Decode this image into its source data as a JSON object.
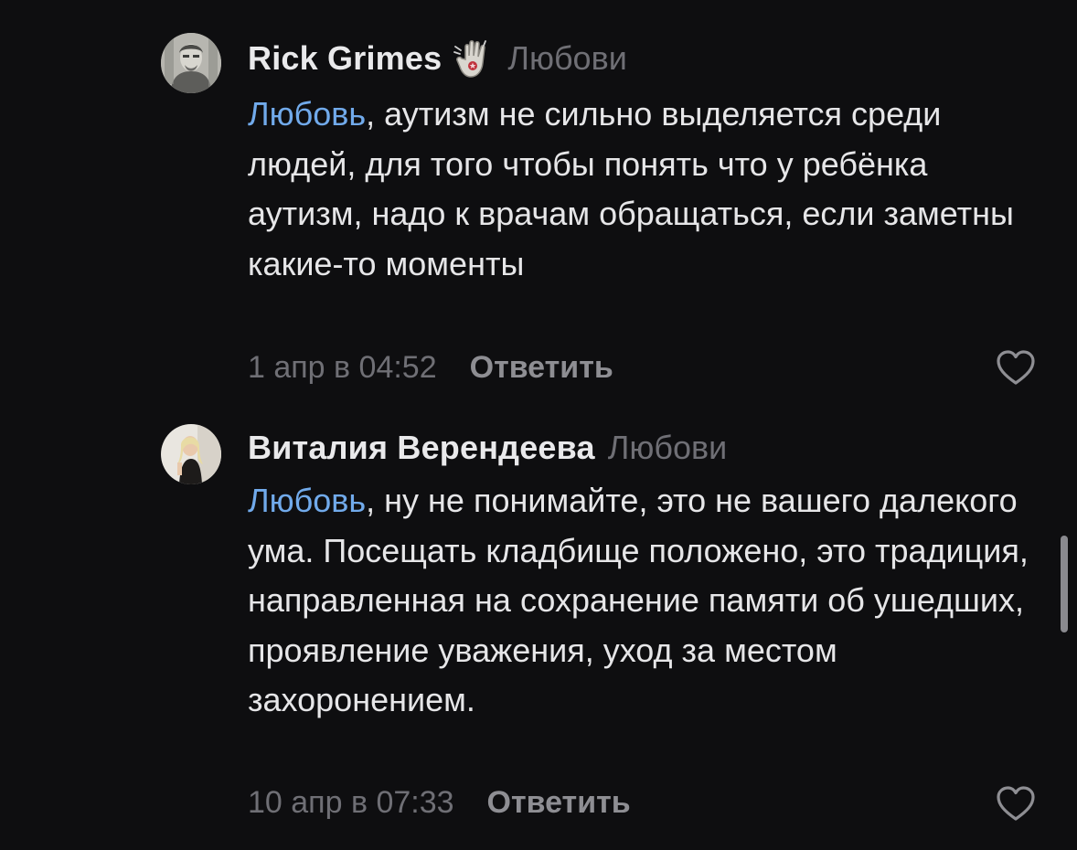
{
  "comments": [
    {
      "author": "Rick Grimes",
      "reply_to": "Любови",
      "mention": "Любовь",
      "text": ", аутизм не сильно выделяется среди людей, для того чтобы понять что у ребёнка аутизм, надо к врачам обращаться, если заметны какие-то моменты",
      "date": "1 апр в 04:52",
      "reply_label": "Ответить",
      "badge_icon": "raised-hand-emoji"
    },
    {
      "author": "Виталия Верендеева",
      "reply_to": "Любови",
      "mention": "Любовь",
      "text": ", ну не понимайте, это не вашего далекого ума. Посещать кладбище положено, это традиция, направленная на сохранение памяти об ушедших, проявление уважения, уход за местом захоронением.",
      "date": "10 апр в 07:33",
      "reply_label": "Ответить"
    }
  ],
  "colors": {
    "background": "#0e0e10",
    "mention": "#71aaeb",
    "secondary_text": "#6f6f75",
    "primary_text": "#e6e6e8"
  }
}
